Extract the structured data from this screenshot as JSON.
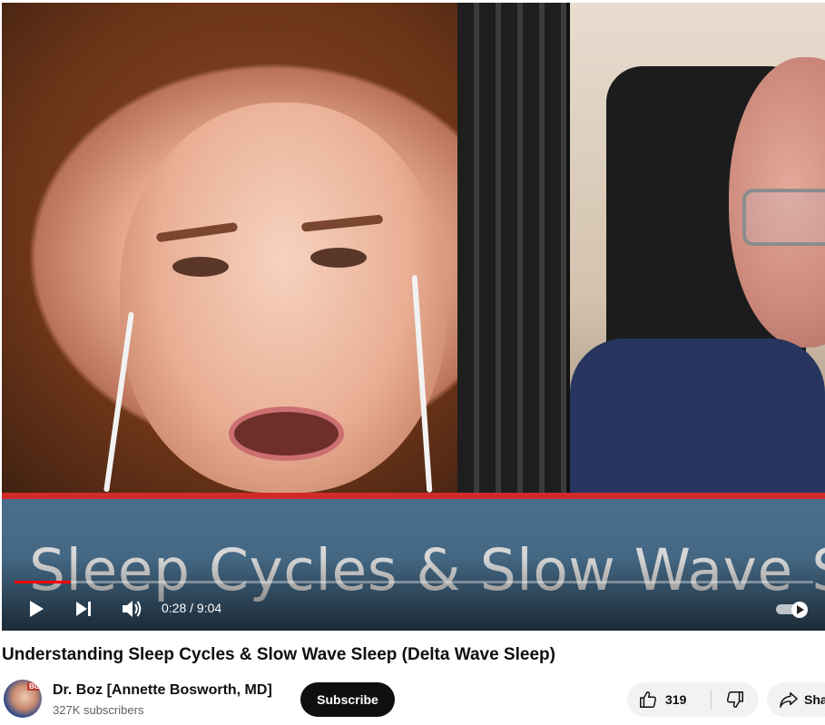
{
  "video": {
    "banner_text": "Sleep Cycles & Slow Wave S",
    "time_display": "0:28 / 9:04",
    "progress_fraction": 0.07,
    "icons": [
      "play-icon",
      "next-icon",
      "volume-icon",
      "autoplay-toggle-icon"
    ]
  },
  "title": "Understanding Sleep Cycles & Slow Wave Sleep (Delta Wave Sleep)",
  "channel": {
    "name": "Dr. Boz [Annette Bosworth, MD]",
    "subscribers": "327K subscribers",
    "avatar_tag": "BOZ"
  },
  "actions": {
    "subscribe_label": "Subscribe",
    "like_count": "319",
    "share_label": "Sha"
  },
  "colors": {
    "progress": "#ff0000",
    "banner_red_line": "#d22a2a",
    "banner": "#4a6f8c",
    "subscribe_bg": "#0f0f0f"
  }
}
